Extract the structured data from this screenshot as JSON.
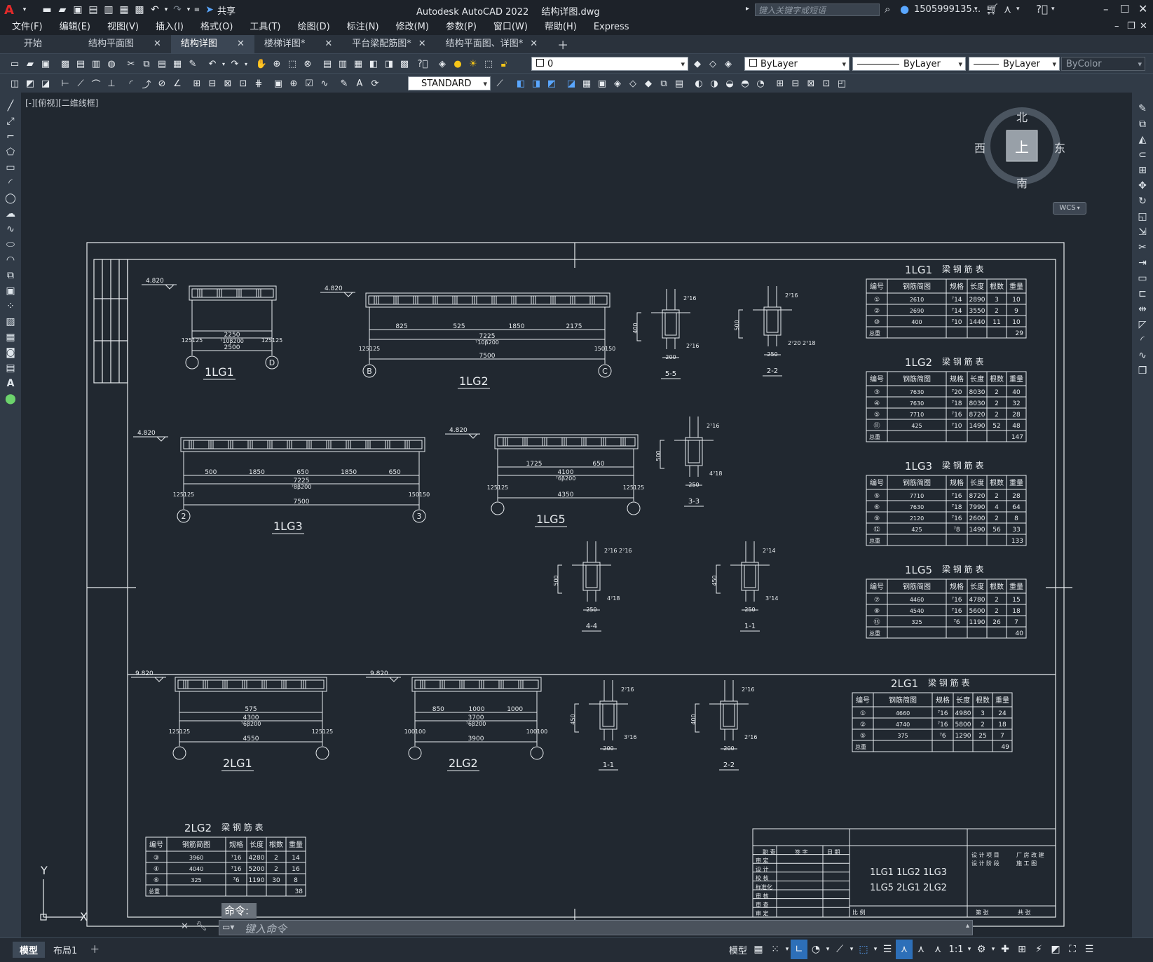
{
  "app": {
    "title": "Autodesk AutoCAD 2022",
    "filename": "结构详图.dwg",
    "share_label": "共享",
    "search_placeholder": "键入关键字或短语",
    "user_name": "1505999135...",
    "logo_letter": "A"
  },
  "menu": [
    "文件(F)",
    "编辑(E)",
    "视图(V)",
    "插入(I)",
    "格式(O)",
    "工具(T)",
    "绘图(D)",
    "标注(N)",
    "修改(M)",
    "参数(P)",
    "窗口(W)",
    "帮助(H)",
    "Express"
  ],
  "tabs": [
    {
      "label": "开始",
      "closable": false,
      "active": false
    },
    {
      "label": "结构平面图",
      "closable": true,
      "active": false
    },
    {
      "label": "结构详图",
      "closable": true,
      "active": true
    },
    {
      "label": "楼梯详图*",
      "closable": true,
      "active": false
    },
    {
      "label": "平台梁配筋图*",
      "closable": true,
      "active": false
    },
    {
      "label": "结构平面图、详图*",
      "closable": true,
      "active": false
    }
  ],
  "toolbar": {
    "layer_value": "0",
    "color_value": "ByLayer",
    "linetype_value": "ByLayer",
    "lineweight_value": "ByLayer",
    "plotstyle_value": "ByColor",
    "textstyle_value": "STANDARD"
  },
  "viewport": {
    "label": "[-][俯视][二维线框]",
    "compass": {
      "n": "北",
      "s": "南",
      "e": "东",
      "w": "西",
      "center": "上",
      "wcs": "WCS"
    },
    "ucs_y": "Y",
    "ucs_x": "X"
  },
  "drawing": {
    "beams": [
      {
        "name": "1LG1",
        "elev": "4.820",
        "span": "2500",
        "mid": "2250",
        "total": "⁷10β200",
        "ends": [
          "125125",
          "125125"
        ],
        "axes": [
          "D"
        ]
      },
      {
        "name": "1LG2",
        "elev": "4.820",
        "span": "7500",
        "dims": [
          "825",
          "525",
          "1850",
          "2175"
        ],
        "mid": "7225",
        "total": "⁷10β200",
        "ends": [
          "125125",
          "150150"
        ],
        "axes": [
          "B",
          "C"
        ]
      },
      {
        "name": "1LG3",
        "elev": "4.820",
        "span": "7500",
        "dims": [
          "500",
          "1850",
          "650",
          "1850",
          "650"
        ],
        "mid": "7225",
        "total": "⁷8β200",
        "ends": [
          "125125",
          "150150"
        ],
        "axes": [
          "2",
          "3"
        ],
        "top": "1850"
      },
      {
        "name": "1LG5",
        "elev": "4.820",
        "span": "4350",
        "dims": [
          "1725",
          "650"
        ],
        "mid": "4100",
        "total": "⁷6β200",
        "ends": [
          "125125",
          "125125"
        ]
      },
      {
        "name": "2LG1",
        "elev": "9.820",
        "span": "4550",
        "dims": [
          "575"
        ],
        "mid": "4300",
        "total": "⁷6β200",
        "ends": [
          "125125",
          "125125"
        ]
      },
      {
        "name": "2LG2",
        "elev": "9.820",
        "span": "3900",
        "dims": [
          "850",
          "1000",
          "1000"
        ],
        "mid": "3700",
        "total": "⁷6β200",
        "ends": [
          "100100",
          "100100"
        ]
      }
    ],
    "sections": [
      {
        "name": "5-5",
        "w": "200",
        "h": "400",
        "top": "2⁷16",
        "bot": "2⁷16"
      },
      {
        "name": "2-2",
        "w": "250",
        "h": "500",
        "top": "2⁷16",
        "bot": "2⁷20 2⁷18"
      },
      {
        "name": "3-3",
        "w": "250",
        "h": "500",
        "top": "2⁷16",
        "bot": "4⁷18"
      },
      {
        "name": "4-4",
        "w": "250",
        "h": "500",
        "top": "2⁷16 2⁷16",
        "bot": "4⁷18"
      },
      {
        "name": "1-1",
        "w": "250",
        "h": "450",
        "top": "2⁷14",
        "bot": "3⁷14"
      },
      {
        "name": "1-1",
        "w": "200",
        "h": "450",
        "top": "2⁷16",
        "bot": "3⁷16"
      },
      {
        "name": "2-2",
        "w": "200",
        "h": "400",
        "top": "2⁷16",
        "bot": "2⁷16"
      }
    ],
    "table_headers": [
      "编号",
      "钢筋简图",
      "规格",
      "长度",
      "根数",
      "重量"
    ],
    "total_label": "总重",
    "table_suffix": "梁 钢 筋 表",
    "tables": [
      {
        "name": "1LG1",
        "rows": [
          [
            "①",
            "2610",
            "⁷14",
            "2890",
            "3",
            "10"
          ],
          [
            "②",
            "2690",
            "⁷14",
            "3550",
            "2",
            "9"
          ],
          [
            "⑩",
            "400",
            "⁷10",
            "1440",
            "11",
            "10"
          ]
        ],
        "total": "29"
      },
      {
        "name": "1LG2",
        "rows": [
          [
            "③",
            "7630",
            "⁷20",
            "8030",
            "2",
            "40"
          ],
          [
            "④",
            "7630",
            "⁷18",
            "8030",
            "2",
            "32"
          ],
          [
            "⑤",
            "7710",
            "⁷16",
            "8720",
            "2",
            "28"
          ],
          [
            "⑪",
            "425",
            "⁷10",
            "1490",
            "52",
            "48"
          ]
        ],
        "total": "147"
      },
      {
        "name": "1LG3",
        "rows": [
          [
            "⑤",
            "7710",
            "⁷16",
            "8720",
            "2",
            "28"
          ],
          [
            "⑥",
            "7630",
            "⁷18",
            "7990",
            "4",
            "64"
          ],
          [
            "⑨",
            "2120",
            "⁷16",
            "2600",
            "2",
            "8"
          ],
          [
            "⑫",
            "425",
            "⁷8",
            "1490",
            "56",
            "33"
          ]
        ],
        "total": "133"
      },
      {
        "name": "1LG5",
        "rows": [
          [
            "⑦",
            "4460",
            "⁷16",
            "4780",
            "2",
            "15"
          ],
          [
            "⑧",
            "4540",
            "⁷16",
            "5600",
            "2",
            "18"
          ],
          [
            "⑬",
            "325",
            "⁷6",
            "1190",
            "26",
            "7"
          ]
        ],
        "total": "40"
      },
      {
        "name": "2LG1",
        "rows": [
          [
            "①",
            "4660",
            "⁷16",
            "4980",
            "3",
            "24"
          ],
          [
            "②",
            "4740",
            "⁷16",
            "5800",
            "2",
            "18"
          ],
          [
            "⑤",
            "375",
            "⁷6",
            "1290",
            "25",
            "7"
          ]
        ],
        "total": "49"
      },
      {
        "name": "2LG2",
        "rows": [
          [
            "③",
            "3960",
            "⁷16",
            "4280",
            "2",
            "14"
          ],
          [
            "④",
            "4040",
            "⁷16",
            "5200",
            "2",
            "16"
          ],
          [
            "⑥",
            "325",
            "⁷6",
            "1190",
            "30",
            "8"
          ]
        ],
        "total": "38"
      }
    ],
    "title_block": {
      "left_headers": [
        "职 责",
        "签 字",
        "日 期"
      ],
      "left_rows": [
        "审 定",
        "设 计",
        "校 核",
        "标准化",
        "审 核",
        "审 查",
        "审 定"
      ],
      "center_line1": "1LG1 1LG2 1LG3",
      "center_line2": "1LG5 2LG1 2LG2",
      "right_row1": [
        "设 计 项 目",
        "厂 房 改 建"
      ],
      "right_row2": [
        "设 计 阶 段",
        "施 工 图"
      ],
      "bottom": [
        "比 例",
        "第 张",
        "共 张"
      ]
    }
  },
  "command": {
    "label": "命令:",
    "placeholder": "键入命令"
  },
  "layout_tabs": [
    "模型",
    "布局1"
  ],
  "status": {
    "model_label": "模型",
    "scale": "1:1"
  }
}
